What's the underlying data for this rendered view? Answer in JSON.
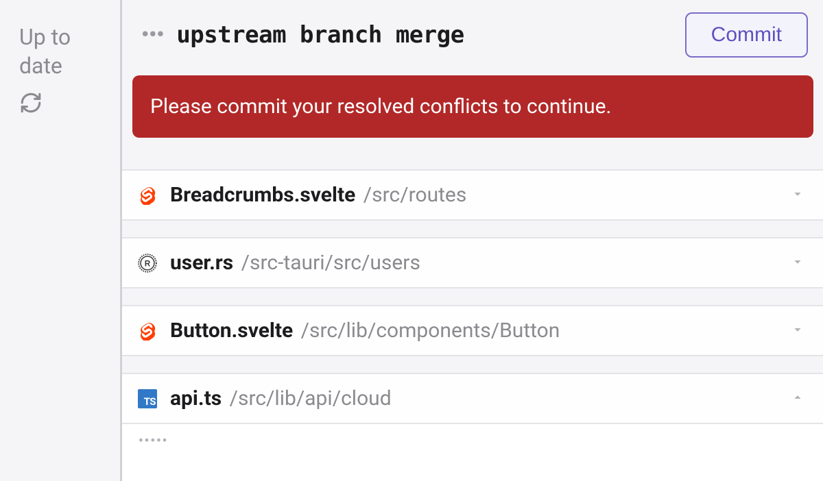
{
  "sidebar": {
    "status": "Up to date"
  },
  "header": {
    "title": "upstream branch merge",
    "commit_label": "Commit"
  },
  "alert": {
    "message": "Please commit your resolved conflicts to continue."
  },
  "files": [
    {
      "icon": "svelte",
      "name": "Breadcrumbs.svelte",
      "path": "/src/routes",
      "expanded": false
    },
    {
      "icon": "rust",
      "name": "user.rs",
      "path": "/src-tauri/src/users",
      "expanded": false
    },
    {
      "icon": "svelte",
      "name": "Button.svelte",
      "path": "/src/lib/components/Button",
      "expanded": false
    },
    {
      "icon": "ts",
      "name": "api.ts",
      "path": "/src/lib/api/cloud",
      "expanded": true
    }
  ],
  "icons": {
    "ts_label": "TS"
  }
}
